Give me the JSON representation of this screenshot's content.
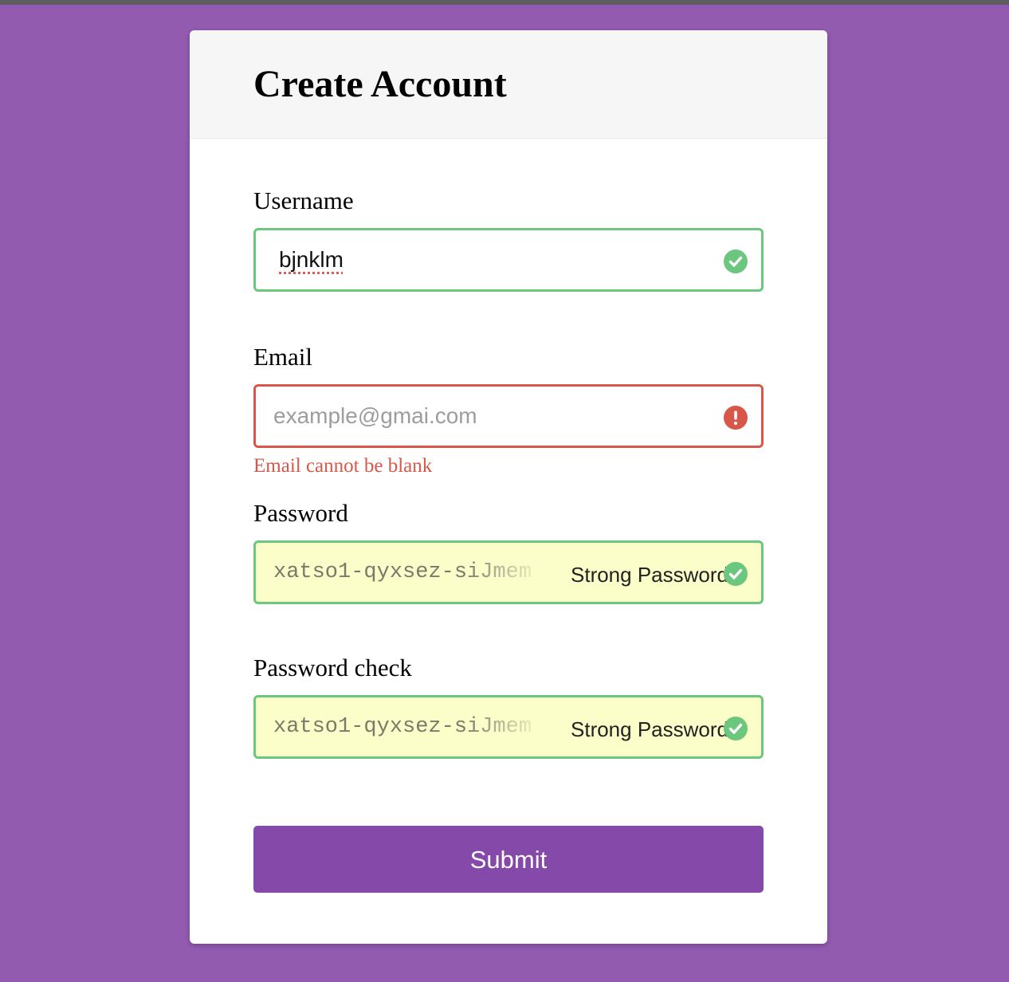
{
  "page": {
    "background_color": "#935bb0"
  },
  "form": {
    "title": "Create Account",
    "username": {
      "label": "Username",
      "value": "bjnklm",
      "status": "valid",
      "status_icon": "check-circle-icon"
    },
    "email": {
      "label": "Email",
      "value": "",
      "placeholder": "example@gmai.com",
      "status": "error",
      "status_icon": "exclamation-circle-icon",
      "error_message": "Email cannot be blank"
    },
    "password": {
      "label": "Password",
      "value": "xatso1-qyxsez-siJmem",
      "autofill_hint": "Strong Password",
      "status": "valid",
      "status_icon": "check-circle-icon"
    },
    "password_check": {
      "label": "Password check",
      "value": "xatso1-qyxsez-siJmem",
      "autofill_hint": "Strong Password",
      "status": "valid",
      "status_icon": "check-circle-icon"
    },
    "submit_label": "Submit"
  },
  "colors": {
    "success": "#6bc77e",
    "error": "#d9574a",
    "accent": "#8549a9",
    "autofill_background": "#fbfec8"
  }
}
